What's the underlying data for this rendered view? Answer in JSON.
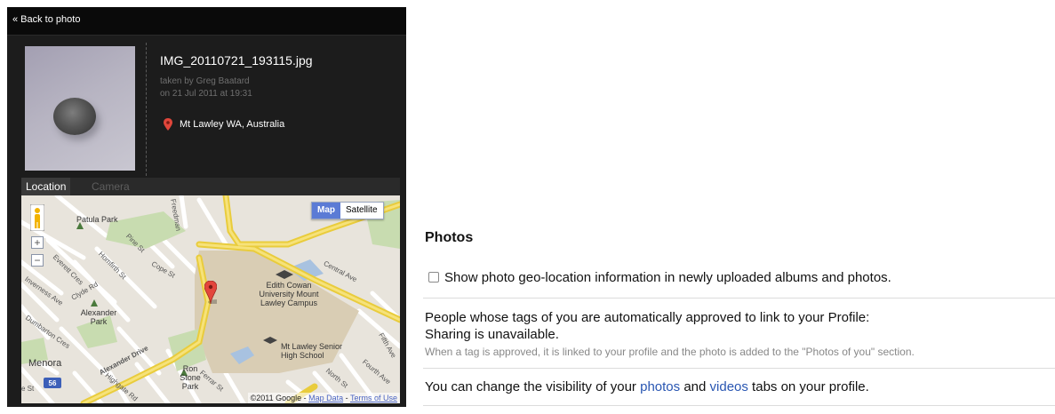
{
  "photo_panel": {
    "back_label": "« Back to photo",
    "filename": "IMG_20110721_193115.jpg",
    "taken_by": "taken by Greg Baatard",
    "taken_on": "on 21 Jul 2011 at 19:31",
    "location": "Mt Lawley WA, Australia",
    "tabs": [
      {
        "label": "Location",
        "active": true
      },
      {
        "label": "Camera",
        "active": false
      }
    ]
  },
  "map": {
    "type_buttons": [
      {
        "label": "Map",
        "active": true
      },
      {
        "label": "Satellite",
        "active": false
      }
    ],
    "zoom_in": "+",
    "zoom_out": "−",
    "places": {
      "patula_park": "Patula Park",
      "edith_cowan": "Edith Cowan University Mount Lawley Campus",
      "alexander_park": "Alexander Park",
      "mt_lawley_senior": "Mt Lawley Senior High School",
      "menora": "Menora",
      "ron_stone": "Ron Stone Park"
    },
    "streets": {
      "freedman": "Freedman",
      "pine": "Pine St",
      "cope": "Cope St",
      "central": "Central Ave",
      "everett": "Everett Cres",
      "homfirth": "Homfirth St",
      "clyde": "Clyde Rd",
      "inverness": "Inverness Ave",
      "dumbarton": "Dumbarton Cres",
      "alexander_dr": "Alexander Drive",
      "fifth": "Fifth Ave",
      "fourth": "Fourth Ave",
      "north": "North St",
      "highgate": "Highgate Rd",
      "ferrar": "Ferrar St",
      "ee_st": "e St",
      "shield": "56"
    },
    "copyright_prefix": "©2011 Google - ",
    "map_data_link": "Map Data",
    "separator": " - ",
    "terms_link": "Terms of Use"
  },
  "settings": {
    "title": "Photos",
    "geo_label": "Show photo geo-location information in newly uploaded albums and photos.",
    "geo_checked": false,
    "tags_heading": "People whose tags of you are automatically approved to link to your Profile:",
    "sharing_status": "Sharing is unavailable.",
    "tags_note": "When a tag is approved, it is linked to your profile and the photo is added to the \"Photos of you\" section.",
    "visibility_prefix": "You can change the visibility of your ",
    "photos_link": "photos",
    "and_word": " and ",
    "videos_link": "videos",
    "visibility_suffix": " tabs on your profile."
  }
}
